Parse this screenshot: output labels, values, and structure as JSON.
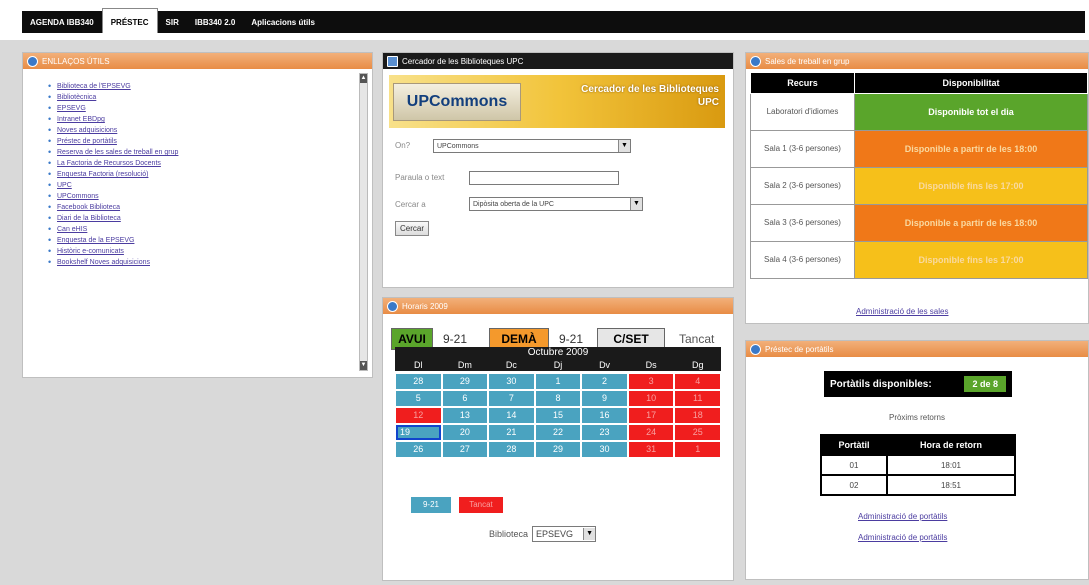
{
  "nav": {
    "tabs": [
      {
        "label": "AGENDA IBB340"
      },
      {
        "label": "PRÉSTEC"
      },
      {
        "label": "SIR"
      },
      {
        "label": "IBB340 2.0"
      },
      {
        "label": "Aplicacions útils"
      }
    ],
    "active_index": 1
  },
  "links_panel": {
    "title": "ENLLAÇOS ÚTILS",
    "items": [
      "Biblioteca de l'EPSEVG",
      "Bibliotècnica",
      "EPSEVG",
      "Intranet EBDpg",
      "Noves adquisicions",
      "Préstec de portàtils",
      "Reserva de les sales de treball en grup",
      "La Factoria de Recursos Docents",
      "Enquesta Factoria (resolució)",
      "UPC",
      "UPCommons",
      "Facebook Biblioteca",
      "Diari de la Biblioteca",
      "Can eHIS",
      "Enquesta de la EPSEVG",
      "Històric e-comunicats",
      "Bookshelf Noves adquisicions"
    ]
  },
  "search_panel": {
    "title": "Cercador de les Biblioteques UPC",
    "logo_text": "UPCommons",
    "banner_title": "Cercador de les Biblioteques UPC",
    "field_on_label": "On?",
    "field_on_value": "UPCommons",
    "field_text_label": "Paraula o text",
    "field_text_value": "",
    "field_in_label": "Cercar a",
    "field_in_value": "Dipòsita oberta de la UPC",
    "search_button": "Cercar"
  },
  "calendar_panel": {
    "title": "Horaris 2009",
    "today_label": "AVUI",
    "today_hours": "9-21",
    "tomorrow_label": "DEMÀ",
    "tomorrow_hours": "9-21",
    "next_label": "C/SET",
    "next_status": "Tancat",
    "month_title": "Octubre 2009",
    "weekdays": [
      "Dl",
      "Dm",
      "Dc",
      "Dj",
      "Dv",
      "Ds",
      "Dg"
    ],
    "weeks": [
      [
        {
          "d": "28",
          "c": "b"
        },
        {
          "d": "29",
          "c": "b"
        },
        {
          "d": "30",
          "c": "b"
        },
        {
          "d": "1",
          "c": "b"
        },
        {
          "d": "2",
          "c": "b"
        },
        {
          "d": "3",
          "c": "r"
        },
        {
          "d": "4",
          "c": "r"
        }
      ],
      [
        {
          "d": "5",
          "c": "b"
        },
        {
          "d": "6",
          "c": "b"
        },
        {
          "d": "7",
          "c": "b"
        },
        {
          "d": "8",
          "c": "b"
        },
        {
          "d": "9",
          "c": "b"
        },
        {
          "d": "10",
          "c": "r"
        },
        {
          "d": "11",
          "c": "r"
        }
      ],
      [
        {
          "d": "12",
          "c": "r"
        },
        {
          "d": "13",
          "c": "b"
        },
        {
          "d": "14",
          "c": "b"
        },
        {
          "d": "15",
          "c": "b"
        },
        {
          "d": "16",
          "c": "b"
        },
        {
          "d": "17",
          "c": "r"
        },
        {
          "d": "18",
          "c": "r"
        }
      ],
      [
        {
          "d": "19",
          "c": "sel"
        },
        {
          "d": "20",
          "c": "b"
        },
        {
          "d": "21",
          "c": "b"
        },
        {
          "d": "22",
          "c": "b"
        },
        {
          "d": "23",
          "c": "b"
        },
        {
          "d": "24",
          "c": "r"
        },
        {
          "d": "25",
          "c": "r"
        }
      ],
      [
        {
          "d": "26",
          "c": "b"
        },
        {
          "d": "27",
          "c": "b"
        },
        {
          "d": "28",
          "c": "b"
        },
        {
          "d": "29",
          "c": "b"
        },
        {
          "d": "30",
          "c": "b"
        },
        {
          "d": "31",
          "c": "r"
        },
        {
          "d": "1",
          "c": "r"
        }
      ]
    ],
    "legend_open": "9-21",
    "legend_closed": "Tancat",
    "library_label": "Biblioteca",
    "library_value": "EPSEVG"
  },
  "rooms_panel": {
    "title": "Sales de treball en grup",
    "col_resource": "Recurs",
    "col_availability": "Disponibilitat",
    "rows": [
      {
        "resource": "Laboratori d'idiomes",
        "status": "Disponible tot el dia",
        "color": "g",
        "faded": false
      },
      {
        "resource": "Sala 1 (3-6 persones)",
        "status": "Disponible a partir de les 18:00",
        "color": "o",
        "faded": true
      },
      {
        "resource": "Sala 2 (3-6 persones)",
        "status": "Disponible fins les 17:00",
        "color": "y",
        "faded": true
      },
      {
        "resource": "Sala 3 (3-6 persones)",
        "status": "Disponible a partir de les 18:00",
        "color": "o",
        "faded": true
      },
      {
        "resource": "Sala 4 (3-6 persones)",
        "status": "Disponible fins les 17:00",
        "color": "y",
        "faded": true
      }
    ],
    "admin_link": "Administració de les sales"
  },
  "laptops_panel": {
    "title": "Préstec de portàtils",
    "available_label": "Portàtils disponibles:",
    "available_value": "2 de 8",
    "next_return_label": "Pròxims retorns",
    "col_laptop": "Portàtil",
    "col_return": "Hora de retorn",
    "rows": [
      {
        "laptop": "01",
        "time": "18:01"
      },
      {
        "laptop": "02",
        "time": "18:51"
      }
    ],
    "admin_link_1": "Administració de portàtils",
    "admin_link_2": "Administració de portàtils"
  },
  "colors": {
    "panel_header": "#e88c45",
    "available_green": "#5aa52b",
    "orange": "#f07818",
    "yellow": "#f6c01a",
    "calendar_blue": "#4aa3c0",
    "calendar_red": "#f01e1e"
  }
}
